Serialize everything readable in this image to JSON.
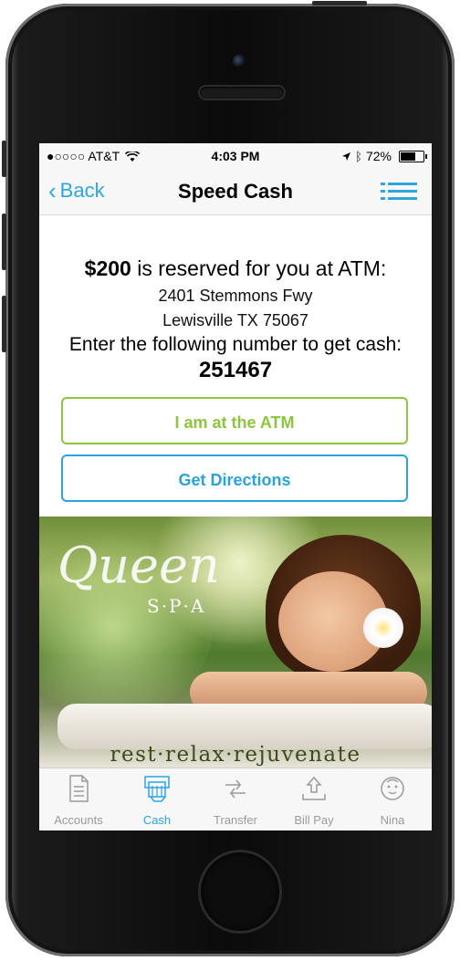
{
  "status_bar": {
    "carrier": "●○○○○ AT&T",
    "time": "4:03 PM",
    "battery": "72%",
    "battery_level": 0.72
  },
  "nav": {
    "back_label": "Back",
    "title": "Speed Cash"
  },
  "reservation": {
    "amount": "$200",
    "message": " is reserved for you at ATM:",
    "address_line1": "2401 Stemmons Fwy",
    "address_line2": "Lewisville TX 75067",
    "instruction": "Enter the following number to get cash:",
    "code": "251467"
  },
  "buttons": {
    "at_atm": "I am at the ATM",
    "directions": "Get Directions"
  },
  "ad": {
    "brand": "Queen",
    "sub": "S·P·A",
    "tagline": "rest·relax·rejuvenate"
  },
  "tabs": [
    {
      "label": "Accounts",
      "icon": "document-icon",
      "active": false
    },
    {
      "label": "Cash",
      "icon": "atm-cash-icon",
      "active": true
    },
    {
      "label": "Transfer",
      "icon": "transfer-arrows-icon",
      "active": false
    },
    {
      "label": "Bill Pay",
      "icon": "upload-tray-icon",
      "active": false
    },
    {
      "label": "Nina",
      "icon": "assistant-face-icon",
      "active": false
    }
  ],
  "colors": {
    "accent_blue": "#2aa6e0",
    "accent_green": "#8cc63f"
  }
}
